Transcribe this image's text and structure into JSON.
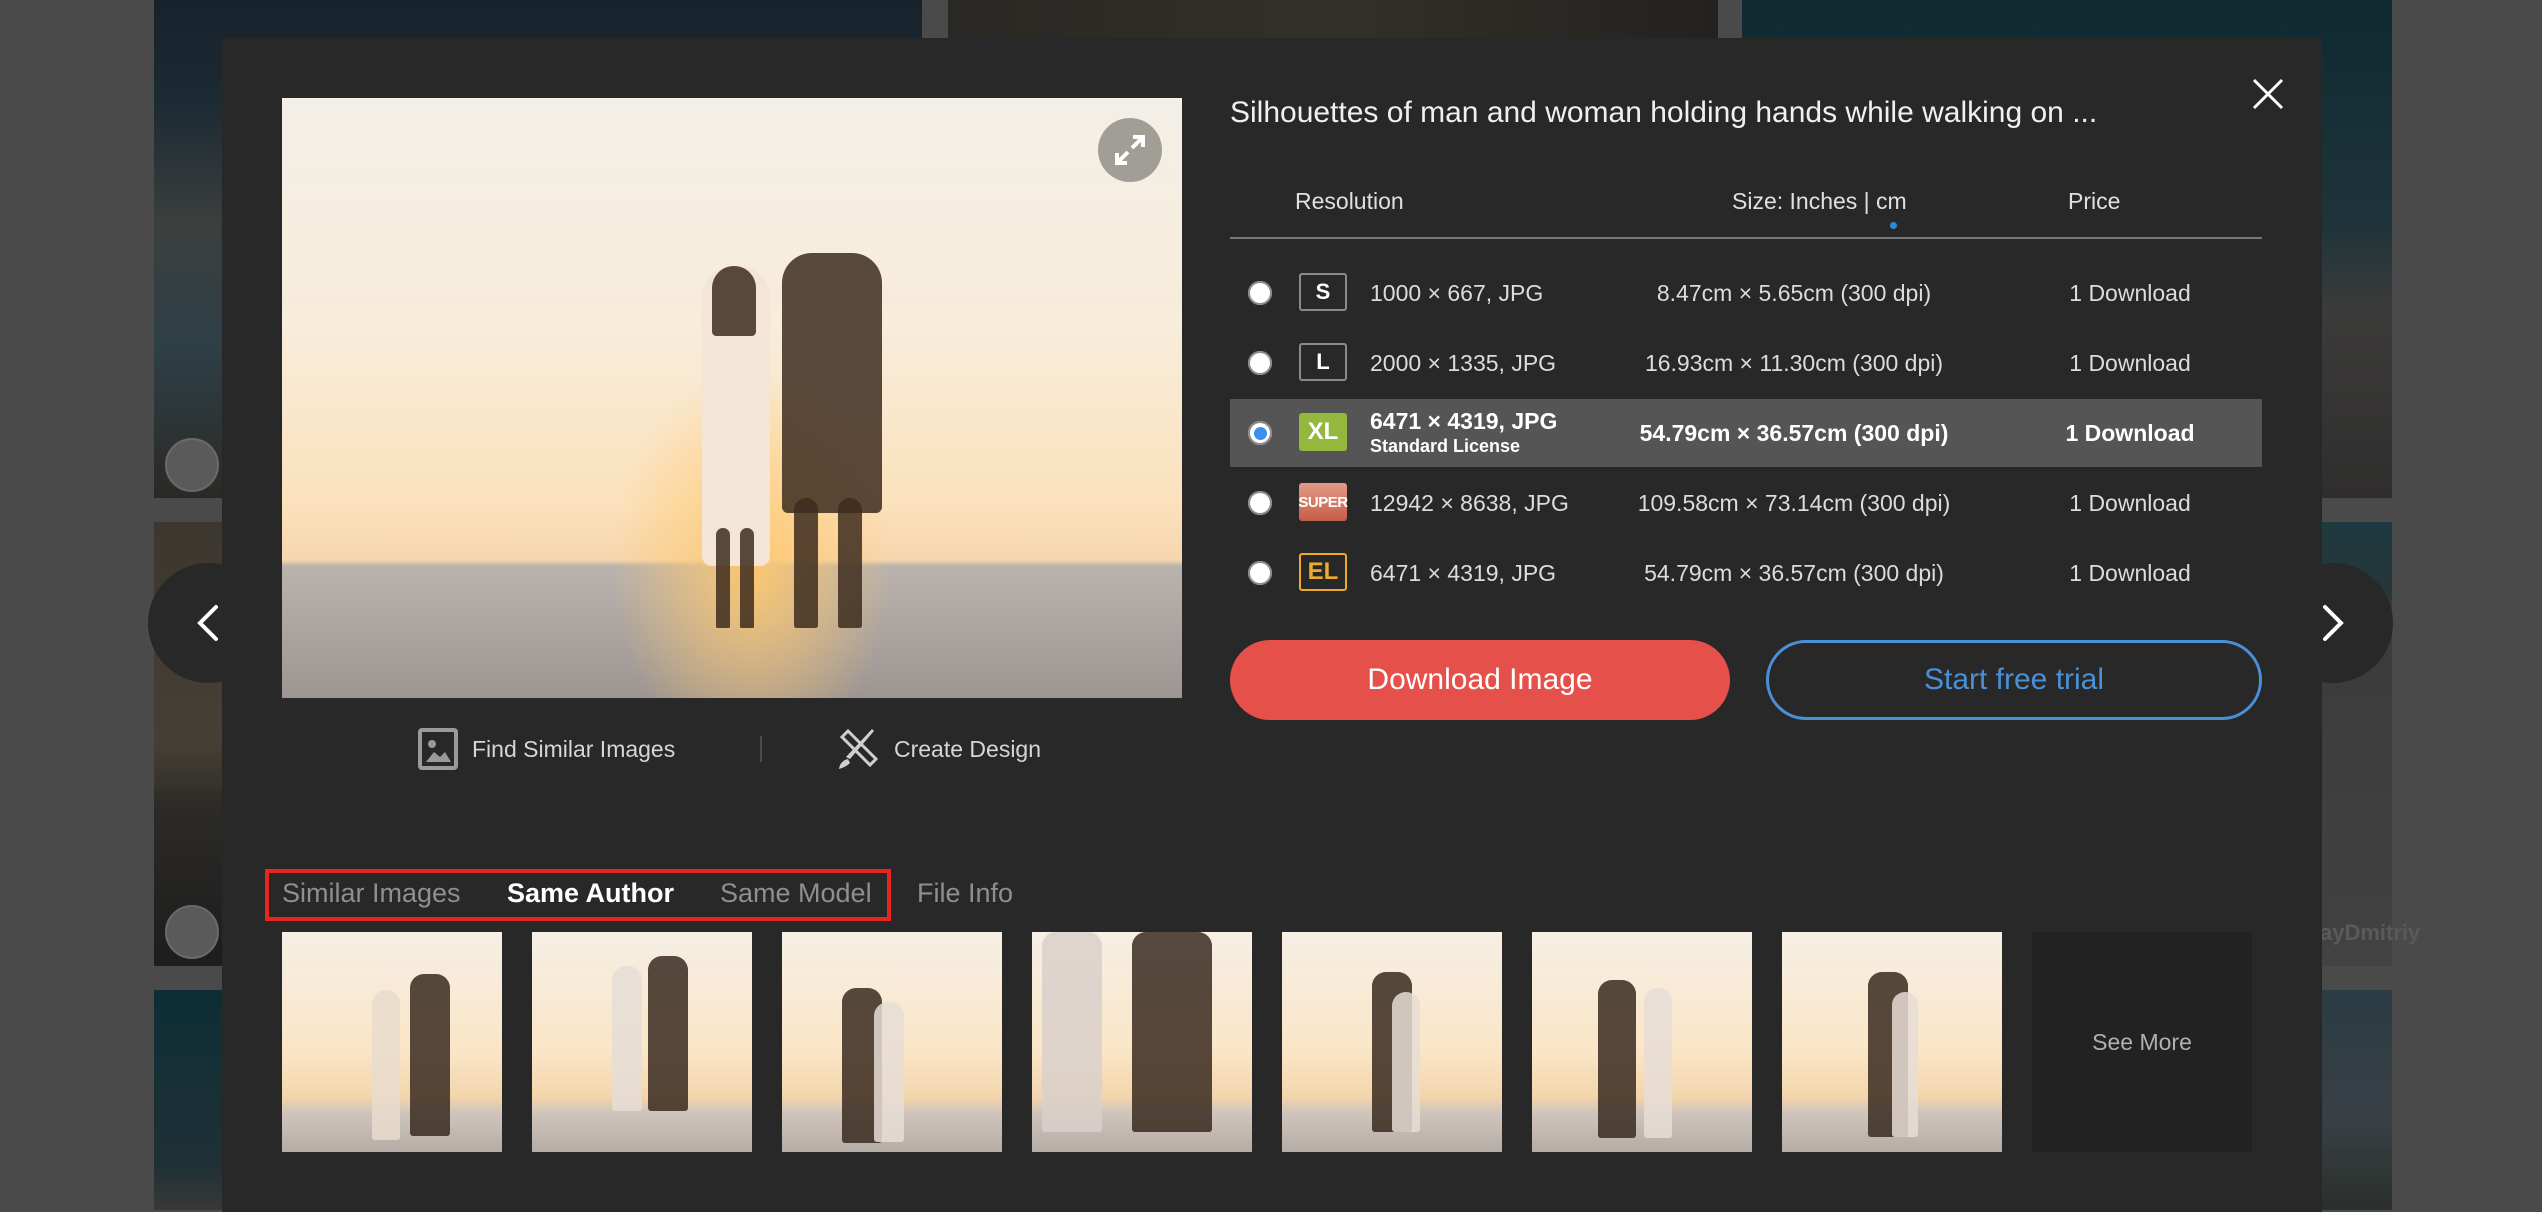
{
  "modal": {
    "title": "Silhouettes of man and woman holding hands while walking on ...",
    "close_icon": "close-icon",
    "expand_icon": "expand-arrows-icon"
  },
  "table": {
    "headers": {
      "resolution": "Resolution",
      "size": "Size: Inches | cm",
      "price": "Price"
    },
    "selected_unit": "cm",
    "rows": [
      {
        "badge": "S",
        "resolution": "1000 × 667, JPG",
        "license": "",
        "size": "8.47cm × 5.65cm (300 dpi)",
        "price": "1 Download",
        "selected": false
      },
      {
        "badge": "L",
        "resolution": "2000 × 1335, JPG",
        "license": "",
        "size": "16.93cm × 11.30cm (300 dpi)",
        "price": "1 Download",
        "selected": false
      },
      {
        "badge": "XL",
        "resolution": "6471 × 4319, JPG",
        "license": "Standard License",
        "size": "54.79cm × 36.57cm (300 dpi)",
        "price": "1 Download",
        "selected": true
      },
      {
        "badge": "SUPER",
        "resolution": "12942 × 8638, JPG",
        "license": "",
        "size": "109.58cm × 73.14cm (300 dpi)",
        "price": "1 Download",
        "selected": false
      },
      {
        "badge": "EL",
        "resolution": "6471 × 4319, JPG",
        "license": "",
        "size": "54.79cm × 36.57cm (300 dpi)",
        "price": "1 Download",
        "selected": false
      }
    ]
  },
  "buttons": {
    "download": "Download Image",
    "trial": "Start free trial"
  },
  "image_actions": {
    "find_similar": "Find Similar Images",
    "create_design": "Create Design"
  },
  "tabs": [
    {
      "label": "Similar Images",
      "active": false
    },
    {
      "label": "Same Author",
      "active": true
    },
    {
      "label": "Same Model",
      "active": false
    },
    {
      "label": "File Info",
      "active": false
    }
  ],
  "thumbnails": {
    "count": 7,
    "see_more": "See More"
  },
  "background": {
    "watermark": "ayDmitriy"
  },
  "colors": {
    "modal_bg": "#282828",
    "download_button": "#e5514a",
    "trial_button": "#4a90d9",
    "selected_row": "#555555",
    "xl_badge": "#94b73d",
    "el_badge": "#f0aa2a",
    "highlight_box": "#e8261f",
    "radio_selected": "#3b8ff0"
  }
}
